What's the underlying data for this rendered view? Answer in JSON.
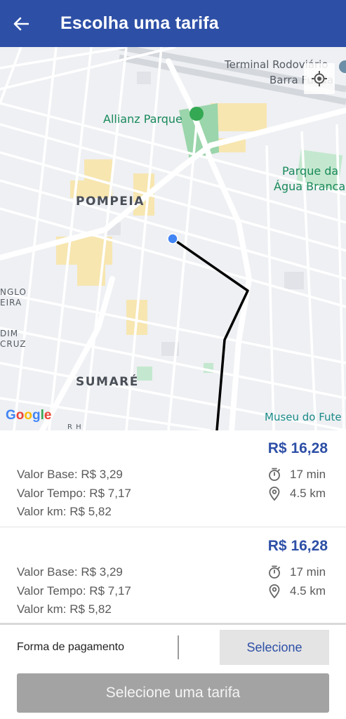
{
  "header": {
    "title": "Escolha uma tarifa",
    "back_icon": "arrow-left-icon"
  },
  "map": {
    "labels": {
      "terminal": "Terminal Rodoviário",
      "barra_funda": "Barra Funda",
      "allianz": "Allianz Parque",
      "parque": "Parque da",
      "agua_branca": "Água Branca",
      "pompeia": "POMPEIA",
      "sumare": "SUMARÉ",
      "museu": "Museu do Fute",
      "anglo": "NGLO",
      "eira": "EIRA",
      "dim": "DIM",
      "cruz": "CRUZ",
      "bh": "R H"
    },
    "google": [
      "G",
      "o",
      "o",
      "g",
      "l",
      "e"
    ],
    "colors": {
      "route": "#000000",
      "user_dot": "#4285f4",
      "park": "#8fd1a5"
    }
  },
  "fares": [
    {
      "price": "R$ 16,28",
      "base": "Valor Base: R$ 3,29",
      "tempo": "Valor Tempo: R$ 7,17",
      "km": "Valor km: R$ 5,82",
      "duration": "17 min",
      "distance": "4.5 km"
    },
    {
      "price": "R$ 16,28",
      "base": "Valor Base: R$ 3,29",
      "tempo": "Valor Tempo: R$ 7,17",
      "km": "Valor km: R$ 5,82",
      "duration": "17 min",
      "distance": "4.5 km"
    }
  ],
  "payment": {
    "label": "Forma de pagamento",
    "select": "Selecione"
  },
  "action": {
    "label": "Selecione uma tarifa"
  },
  "colors": {
    "primary": "#2d4fa6",
    "disabled": "#a3a3a3"
  }
}
